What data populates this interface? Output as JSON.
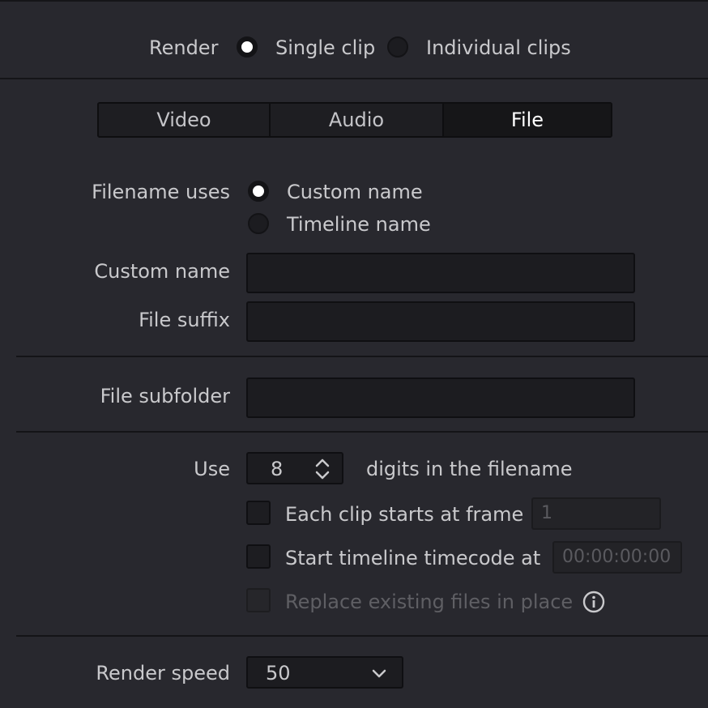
{
  "render_mode": {
    "label": "Render",
    "options": [
      {
        "label": "Single clip",
        "selected": true
      },
      {
        "label": "Individual clips",
        "selected": false
      }
    ]
  },
  "tabs": [
    {
      "label": "Video",
      "active": false
    },
    {
      "label": "Audio",
      "active": false
    },
    {
      "label": "File",
      "active": true
    }
  ],
  "filename_uses": {
    "label": "Filename uses",
    "options": [
      {
        "label": "Custom name",
        "selected": true
      },
      {
        "label": "Timeline name",
        "selected": false
      }
    ]
  },
  "custom_name": {
    "label": "Custom name",
    "value": ""
  },
  "file_suffix": {
    "label": "File suffix",
    "value": ""
  },
  "file_subfolder": {
    "label": "File subfolder",
    "value": ""
  },
  "digits": {
    "prefix": "Use",
    "value": "8",
    "suffix": "digits in the filename"
  },
  "each_clip": {
    "label": "Each clip starts at frame",
    "checked": false,
    "value": "1"
  },
  "start_timecode": {
    "label": "Start timeline timecode at",
    "checked": false,
    "value": "00:00:00:00"
  },
  "replace_files": {
    "label": "Replace existing files in place",
    "checked": false,
    "disabled": true
  },
  "render_speed": {
    "label": "Render speed",
    "value": "50"
  },
  "icons": {
    "stepper": "chevron-updown-icon",
    "dropdown": "chevron-down-icon",
    "info": "info-icon"
  }
}
